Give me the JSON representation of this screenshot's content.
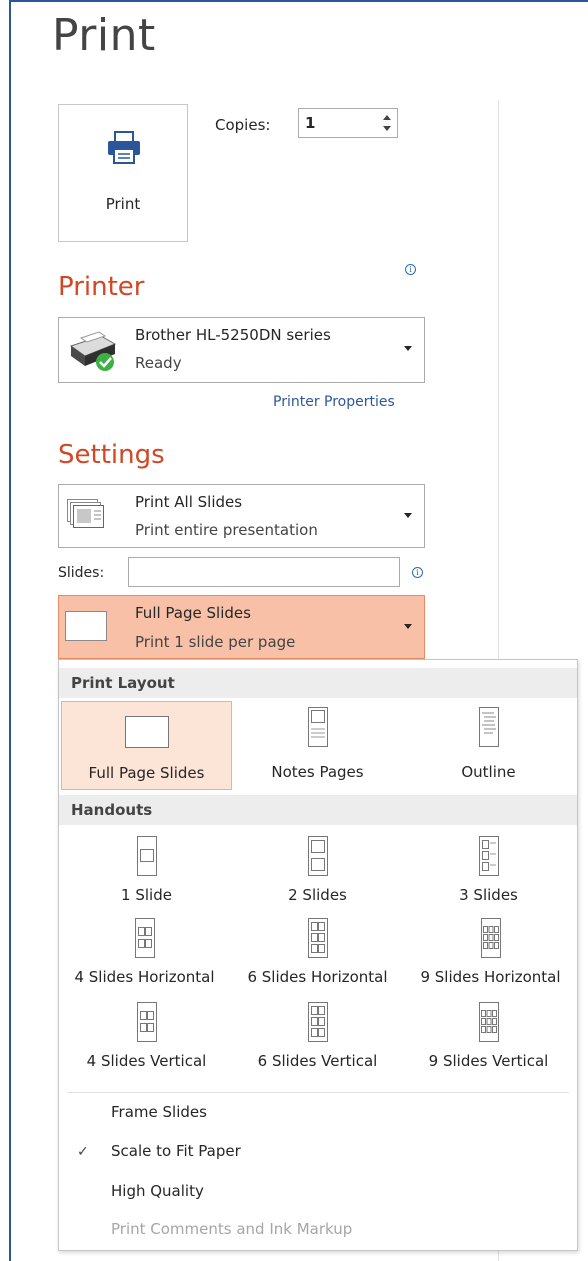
{
  "page": {
    "title": "Print"
  },
  "print_button": {
    "label": "Print",
    "icon": "printer-icon"
  },
  "copies": {
    "label": "Copies:",
    "value": "1"
  },
  "printer": {
    "section_title": "Printer",
    "name": "Brother HL-5250DN series",
    "status": "Ready",
    "properties_link": "Printer Properties"
  },
  "settings": {
    "section_title": "Settings",
    "range": {
      "title": "Print All Slides",
      "subtitle": "Print entire presentation"
    },
    "slides_label": "Slides:",
    "slides_value": "",
    "layout": {
      "title": "Full Page Slides",
      "subtitle": "Print 1 slide per page"
    }
  },
  "layout_menu": {
    "print_layout_header": "Print Layout",
    "print_layout_items": [
      {
        "label": "Full Page Slides",
        "selected": true
      },
      {
        "label": "Notes Pages",
        "selected": false
      },
      {
        "label": "Outline",
        "selected": false
      }
    ],
    "handouts_header": "Handouts",
    "handout_items": [
      {
        "label": "1 Slide"
      },
      {
        "label": "2 Slides"
      },
      {
        "label": "3 Slides"
      },
      {
        "label": "4 Slides Horizontal"
      },
      {
        "label": "6 Slides Horizontal"
      },
      {
        "label": "9 Slides Horizontal"
      },
      {
        "label": "4 Slides Vertical"
      },
      {
        "label": "6 Slides Vertical"
      },
      {
        "label": "9 Slides Vertical"
      }
    ],
    "options": [
      {
        "label": "Frame Slides",
        "checked": false,
        "enabled": true
      },
      {
        "label": "Scale to Fit Paper",
        "checked": true,
        "enabled": true
      },
      {
        "label": "High Quality",
        "checked": false,
        "enabled": true
      },
      {
        "label": "Print Comments and Ink Markup",
        "checked": false,
        "enabled": false
      }
    ]
  },
  "colors": {
    "accent": "#d24726",
    "selected_bg": "#f7c0a7",
    "link": "#2b579a",
    "frame": "#2b579a"
  }
}
